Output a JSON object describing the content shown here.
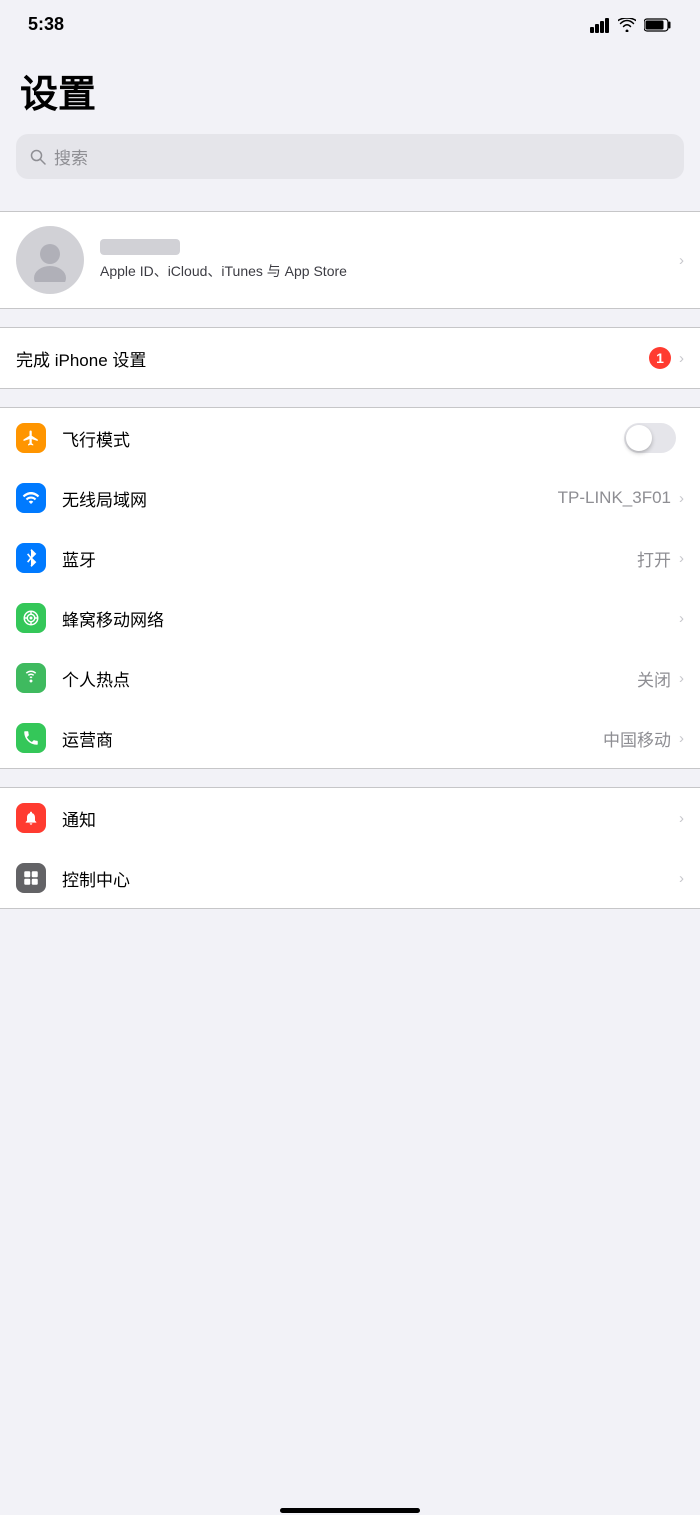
{
  "statusBar": {
    "time": "5:38",
    "signal": "▲▲▲",
    "wifi": "wifi",
    "battery": "battery"
  },
  "pageTitle": "设置",
  "search": {
    "placeholder": "搜索"
  },
  "profile": {
    "subtitle": "Apple ID、iCloud、iTunes 与 App Store"
  },
  "setupItem": {
    "label": "完成 iPhone 设置",
    "badge": "1"
  },
  "networkItems": [
    {
      "id": "airplane",
      "label": "飞行模式",
      "value": "",
      "hasToggle": true,
      "hasChevron": false
    },
    {
      "id": "wifi",
      "label": "无线局域网",
      "value": "TP-LINK_3F01",
      "hasToggle": false,
      "hasChevron": true
    },
    {
      "id": "bluetooth",
      "label": "蓝牙",
      "value": "打开",
      "hasToggle": false,
      "hasChevron": true
    },
    {
      "id": "cellular",
      "label": "蜂窝移动网络",
      "value": "",
      "hasToggle": false,
      "hasChevron": true
    },
    {
      "id": "hotspot",
      "label": "个人热点",
      "value": "关闭",
      "hasToggle": false,
      "hasChevron": true
    },
    {
      "id": "carrier",
      "label": "运营商",
      "value": "中国移动",
      "hasToggle": false,
      "hasChevron": true
    }
  ],
  "systemItems": [
    {
      "id": "notification",
      "label": "通知",
      "value": "",
      "hasChevron": true
    },
    {
      "id": "control",
      "label": "控制中心",
      "value": "",
      "hasChevron": true
    }
  ],
  "icons": {
    "airplane": "✈",
    "wifi": "📶",
    "bluetooth": "🔵",
    "cellular": "📡",
    "hotspot": "🔗",
    "carrier": "📞",
    "notification": "🔔",
    "control": "⚙"
  }
}
